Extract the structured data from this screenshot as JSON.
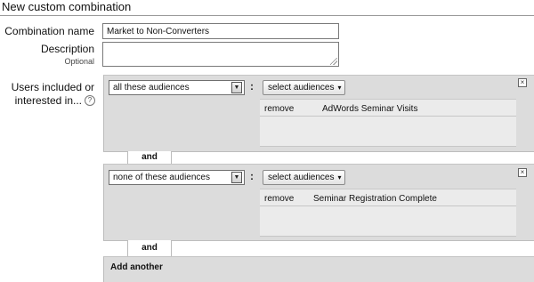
{
  "page": {
    "title": "New custom combination"
  },
  "form": {
    "combination_name_label": "Combination name",
    "combination_name_value": "Market to Non-Converters",
    "description_label": "Description",
    "description_optional": "Optional",
    "description_value": "",
    "users_label_line1": "Users included or",
    "users_label_line2": "interested in...",
    "help_icon_glyph": "?"
  },
  "groups": [
    {
      "condition": "all these audiences",
      "select_button": "select audiences",
      "close_glyph": "×",
      "items": [
        {
          "action": "remove",
          "name": "AdWords Seminar Visits"
        }
      ]
    },
    {
      "condition": "none of these audiences",
      "select_button": "select audiences",
      "close_glyph": "×",
      "items": [
        {
          "action": "remove",
          "name": "Seminar Registration Complete"
        }
      ]
    }
  ],
  "connectors": {
    "and_1": "and",
    "and_2": "and"
  },
  "footer": {
    "add_another": "Add another"
  },
  "glyphs": {
    "colon": ":",
    "dropdown": "▼",
    "caret": "▾"
  },
  "colors": {
    "panel_bg": "#dcdcdc",
    "list_bg": "#ebebeb"
  }
}
